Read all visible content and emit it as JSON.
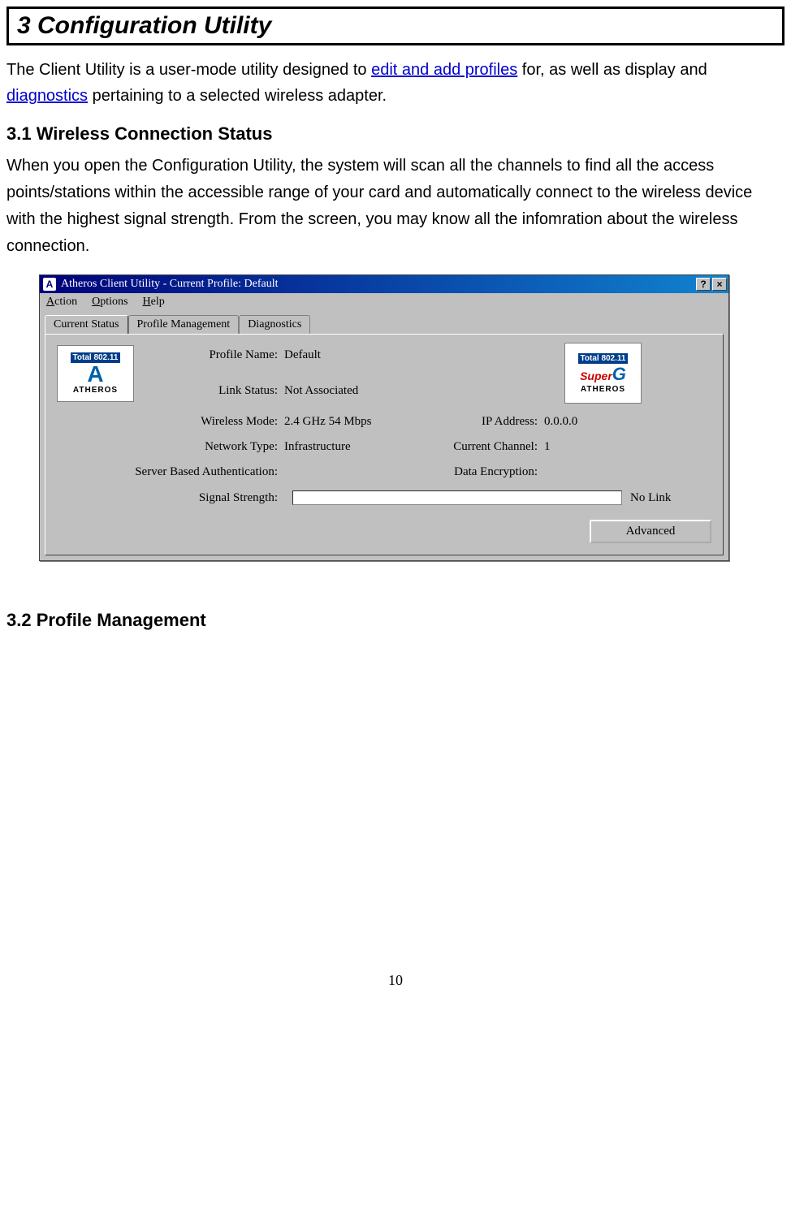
{
  "doc": {
    "chapter_heading": "3  Configuration Utility",
    "intro_prefix": "The Client Utility is a user-mode utility designed to ",
    "intro_link1": "edit and add profiles",
    "intro_mid": " for, as well as display and ",
    "intro_link2": "diagnostics",
    "intro_suffix": " pertaining to a selected wireless adapter.",
    "sec31_heading": "3.1    Wireless Connection Status",
    "sec31_body": "When you open the Configuration Utility, the system will scan all the channels to find all the access points/stations within the accessible range of your card and automatically connect to the wireless device with the highest signal strength. From the screen, you may know all the infomration about the wireless connection.",
    "sec32_heading": "3.2    Profile Management",
    "page_number": "10"
  },
  "app": {
    "titlebar_icon": "A",
    "title": "Atheros Client Utility - Current Profile: Default",
    "help_btn": "?",
    "close_btn": "×",
    "menus": {
      "action": "Action",
      "options": "Options",
      "help": "Help"
    },
    "tabs": {
      "current_status": "Current Status",
      "profile_management": "Profile Management",
      "diagnostics": "Diagnostics"
    },
    "labels": {
      "profile_name": "Profile Name:",
      "link_status": "Link Status:",
      "wireless_mode": "Wireless Mode:",
      "network_type": "Network Type:",
      "server_auth": "Server Based Authentication:",
      "ip_address": "IP Address:",
      "current_channel": "Current Channel:",
      "data_encryption": "Data Encryption:",
      "signal_strength": "Signal Strength:"
    },
    "values": {
      "profile_name": "Default",
      "link_status": "Not Associated",
      "wireless_mode": "2.4 GHz 54 Mbps",
      "network_type": "Infrastructure",
      "server_auth": "",
      "ip_address": "0.0.0.0",
      "current_channel": "1",
      "data_encryption": "",
      "signal_strength_text": "No Link"
    },
    "logo1": {
      "top": "Total 802.11",
      "mid": "A",
      "bot": "ATHEROS"
    },
    "logo2": {
      "top": "Total 802.11",
      "super": "Super",
      "g": "G",
      "bot": "ATHEROS"
    },
    "advanced_btn": "Advanced"
  }
}
